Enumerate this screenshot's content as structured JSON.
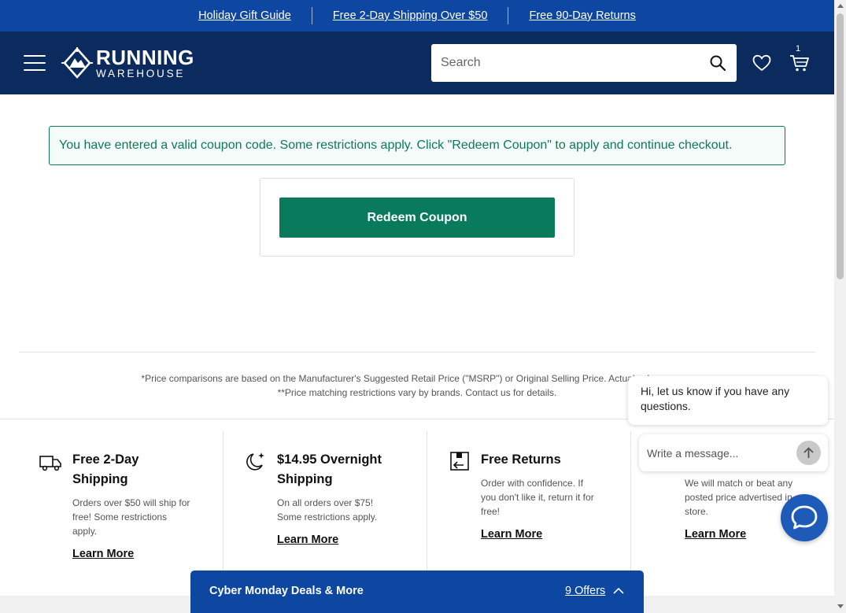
{
  "promo_bar": {
    "links": [
      "Holiday Gift Guide",
      "Free 2-Day Shipping Over $50",
      "Free 90-Day Returns"
    ]
  },
  "header": {
    "logo_line1": "RUNNING",
    "logo_line2": "WAREHOUSE",
    "search_placeholder": "Search",
    "cart_count": "1"
  },
  "alert": {
    "message": "You have entered a valid coupon code. Some restrictions apply. Click \"Redeem Coupon\" to apply and continue checkout."
  },
  "redeem": {
    "button_label": "Redeem Coupon"
  },
  "disclaimers": {
    "line1": "*Price comparisons are based on the Manufacturer's Suggested Retail Price (\"MSRP\") or Original Selling Price. Actual sales may no",
    "line2": "**Price matching restrictions vary by brands. Contact us for details."
  },
  "features": [
    {
      "title": "Free 2-Day Shipping",
      "desc": "Orders over $50 will ship for free! Some restrictions apply.",
      "link": "Learn More",
      "icon": "truck-icon"
    },
    {
      "title": "$14.95 Overnight Shipping",
      "desc": "On all orders over $75! Some restrictions apply.",
      "link": "Learn More",
      "icon": "moon-icon"
    },
    {
      "title": "Free Returns",
      "desc": "Order with confidence. If you don't like it, return it for free!",
      "link": "Learn More",
      "icon": "return-box-icon"
    },
    {
      "title": "",
      "desc": "We will match or beat any posted price advertised in store.",
      "link": "Learn More",
      "icon": "price-tag-icon"
    }
  ],
  "offers_bar": {
    "title": "Cyber Monday Deals & More",
    "count": "9 Offers"
  },
  "chat": {
    "greeting": "Hi, let us know if you have any questions.",
    "input_placeholder": "Write a message..."
  },
  "colors": {
    "promo_blue": "#0d47a1",
    "header_navy": "#0b2b5e",
    "success_green": "#0f7a5a",
    "button_green": "#0a7a5c"
  }
}
